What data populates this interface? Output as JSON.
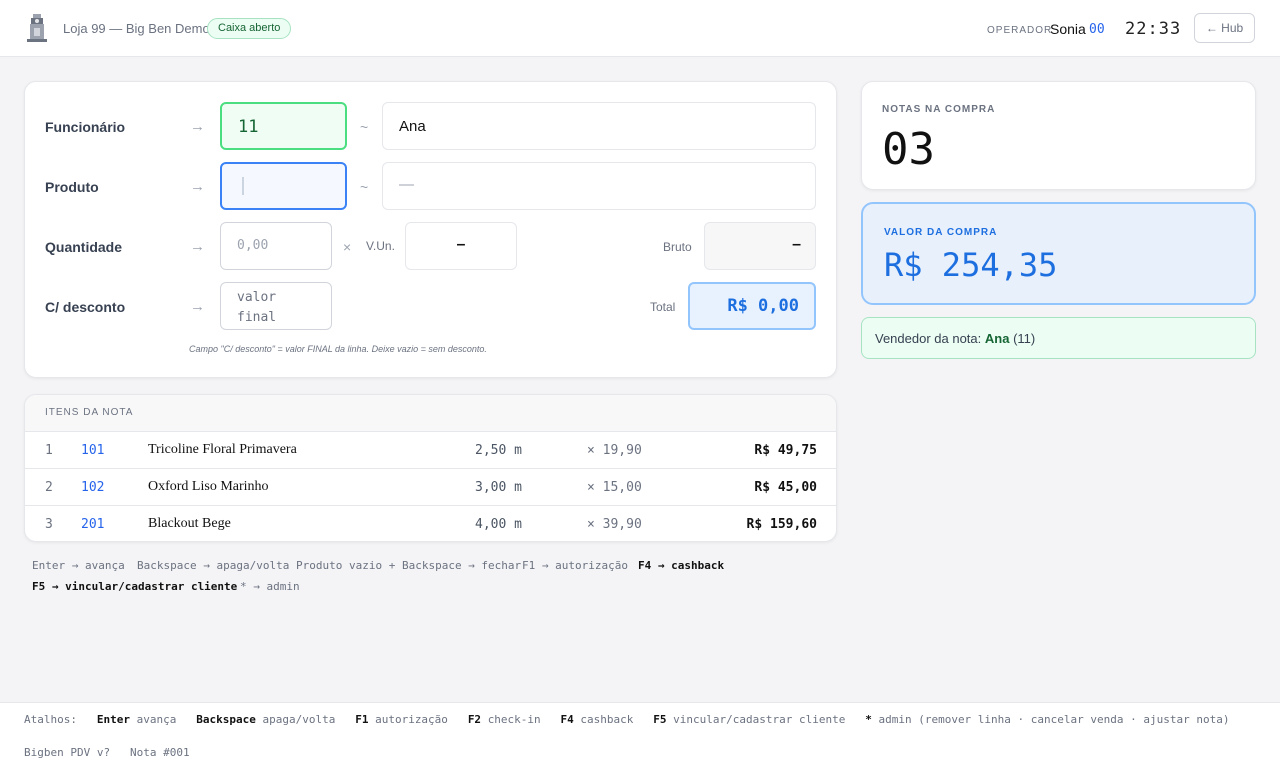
{
  "header": {
    "logo_icon": "clock-tower-icon",
    "store_name": "Loja 99 — Big Ben Demo",
    "status_badge": "Caixa aberto",
    "operator_label": "OPERADOR",
    "operator_name": "Sonia",
    "operator_code": "00",
    "clock": "22:33",
    "hub_button": "← Hub"
  },
  "form": {
    "arrow": "→",
    "tilde": "~",
    "funcionario": {
      "label": "Funcionário",
      "value": "11",
      "name": "Ana"
    },
    "produto": {
      "label": "Produto",
      "value": "",
      "name_placeholder": "—"
    },
    "quantidade": {
      "label": "Quantidade",
      "placeholder": "0,00",
      "times": "×",
      "vun_label": "V.Un.",
      "vun_value": "–",
      "bruto_label": "Bruto",
      "bruto_value": "–"
    },
    "desconto": {
      "label": "C/ desconto",
      "placeholder": "valor final",
      "total_label": "Total",
      "total_value": "R$ 0,00"
    },
    "hint": "Campo \"C/ desconto\" = valor FINAL da linha. Deixe vazio = sem desconto."
  },
  "items": {
    "title": "ITENS DA NOTA",
    "rows": [
      {
        "n": "1",
        "code": "101",
        "desc": "Tricoline Floral Primavera",
        "qty": "2,50 m",
        "unit": "× 19,90",
        "total": "R$ 49,75"
      },
      {
        "n": "2",
        "code": "102",
        "desc": "Oxford Liso Marinho",
        "qty": "3,00 m",
        "unit": "× 15,00",
        "total": "R$ 45,00"
      },
      {
        "n": "3",
        "code": "201",
        "desc": "Blackout Bege",
        "qty": "4,00 m",
        "unit": "× 39,90",
        "total": "R$ 159,60"
      }
    ]
  },
  "shortcuts_panel": [
    "Enter → avança",
    "Backspace → apaga/volta",
    "Produto vazio + Backspace → fechar",
    "F1 → autorização",
    "F4 → cashback",
    "F5 → vincular/cadastrar cliente",
    "* → admin"
  ],
  "summary": {
    "notas_label": "NOTAS NA COMPRA",
    "notas_value": "03",
    "valor_label": "VALOR DA COMPRA",
    "valor_value": "R$ 254,35",
    "vendedor_label": "Vendedor da nota:",
    "vendedor_name": "Ana",
    "vendedor_code": "(11)"
  },
  "footer": {
    "atalhos_label": "Atalhos:",
    "shortcuts": [
      {
        "key": "Enter",
        "desc": "avança"
      },
      {
        "key": "Backspace",
        "desc": "apaga/volta"
      },
      {
        "key": "F1",
        "desc": "autorização"
      },
      {
        "key": "F2",
        "desc": "check-in"
      },
      {
        "key": "F4",
        "desc": "cashback"
      },
      {
        "key": "F5",
        "desc": "vincular/cadastrar cliente"
      },
      {
        "key": "*",
        "desc": "admin (remover linha · cancelar venda · ajustar nota)"
      }
    ],
    "version": "Bigben PDV v?",
    "nota": "Nota #001"
  }
}
